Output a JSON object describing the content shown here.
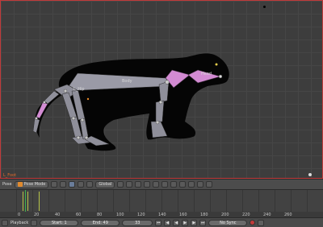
{
  "viewport": {
    "label": "L_Foot",
    "bones": {
      "body": "Body",
      "hip": "L_Hip",
      "head": "Head"
    }
  },
  "header": {
    "view_menu": "Pose",
    "mode": "Pose Mode",
    "orientation": "Global"
  },
  "timeline": {
    "ticks": [
      "0",
      "20",
      "40",
      "60",
      "80",
      "100",
      "120",
      "140",
      "160",
      "180",
      "200",
      "220",
      "240",
      "260"
    ]
  },
  "status": {
    "playback": "Playback",
    "start": "Start: 1",
    "end": "End: 49",
    "current": "33",
    "sync": "No Sync"
  },
  "colors": {
    "selection": "#d38bd3",
    "bone": "#8f8f9a",
    "border": "#c13a3a"
  },
  "icons": [
    "view-icon",
    "viewport-shading-icon",
    "snap-icon",
    "manipulator-icon",
    "play-icon",
    "record-icon",
    "keying-icon"
  ]
}
